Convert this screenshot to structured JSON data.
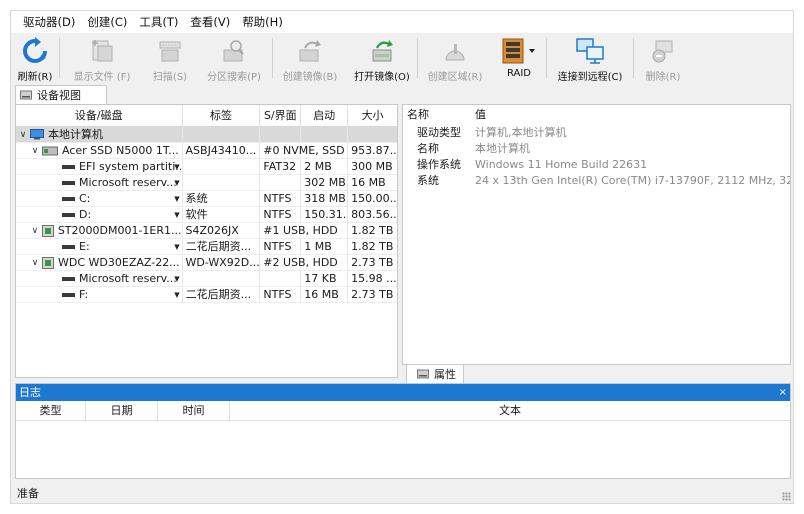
{
  "menubar": [
    "驱动器(D)",
    "创建(C)",
    "工具(T)",
    "查看(V)",
    "帮助(H)"
  ],
  "toolbar": {
    "refresh": "刷新(R)",
    "show_files": "显示文件 (F)",
    "scan": "扫描(S)",
    "partition_search": "分区搜索(P)",
    "create_image": "创建镜像(B)",
    "open_image": "打开镜像(O)",
    "create_region": "创建区域(R)",
    "raid": "RAID",
    "connect_remote": "连接到远程(C)",
    "delete": "删除(R)"
  },
  "device_tab": "设备视图",
  "properties_tab": "属性",
  "device_grid": {
    "headers": [
      "设备/磁盘",
      "标签",
      "S/界面",
      "启动",
      "大小"
    ],
    "rows": [
      {
        "name": "本地计算机",
        "label": "",
        "fs": "",
        "start": "",
        "size": ""
      },
      {
        "name": "Acer SSD N5000 1T...",
        "label": "ASBJ43410...",
        "fs": "#0 NVME, SSD",
        "start": "",
        "size": "953.87..."
      },
      {
        "name": "EFI system partiti...",
        "label": "",
        "fs": "FAT32",
        "start": "2 MB",
        "size": "300 MB"
      },
      {
        "name": "Microsoft reserv...",
        "label": "",
        "fs": "",
        "start": "302 MB",
        "size": "16 MB"
      },
      {
        "name": "C:",
        "label": "系统",
        "fs": "NTFS",
        "start": "318 MB",
        "size": "150.00..."
      },
      {
        "name": "D:",
        "label": "软件",
        "fs": "NTFS",
        "start": "150.31...",
        "size": "803.56..."
      },
      {
        "name": "ST2000DM001-1ER1...",
        "label": "S4Z026JX",
        "fs": "#1 USB, HDD",
        "start": "",
        "size": "1.82 TB"
      },
      {
        "name": "E:",
        "label": "二花后期资...",
        "fs": "NTFS",
        "start": "1 MB",
        "size": "1.82 TB"
      },
      {
        "name": "WDC WD30EZAZ-22...",
        "label": "WD-WX92D...",
        "fs": "#2 USB, HDD",
        "start": "",
        "size": "2.73 TB"
      },
      {
        "name": "Microsoft reserv...",
        "label": "",
        "fs": "",
        "start": "17 KB",
        "size": "15.98 ..."
      },
      {
        "name": "F:",
        "label": "二花后期资...",
        "fs": "NTFS",
        "start": "16 MB",
        "size": "2.73 TB"
      }
    ]
  },
  "properties": {
    "headers": [
      "名称",
      "值"
    ],
    "rows": [
      {
        "key": "驱动类型",
        "value": "计算机,本地计算机"
      },
      {
        "key": "名称",
        "value": "本地计算机"
      },
      {
        "key": "操作系统",
        "value": "Windows 11 Home Build 22631"
      },
      {
        "key": "系统",
        "value": "24 x 13th Gen Intel(R) Core(TM) i7-13790F, 2112 MHz, 32..."
      }
    ]
  },
  "log": {
    "title": "日志",
    "close": "×",
    "headers": [
      "类型",
      "日期",
      "时间",
      "文本"
    ]
  },
  "status": "准备",
  "colors": {
    "accent": "#1e78d2",
    "selection": "#d9d9d9"
  }
}
